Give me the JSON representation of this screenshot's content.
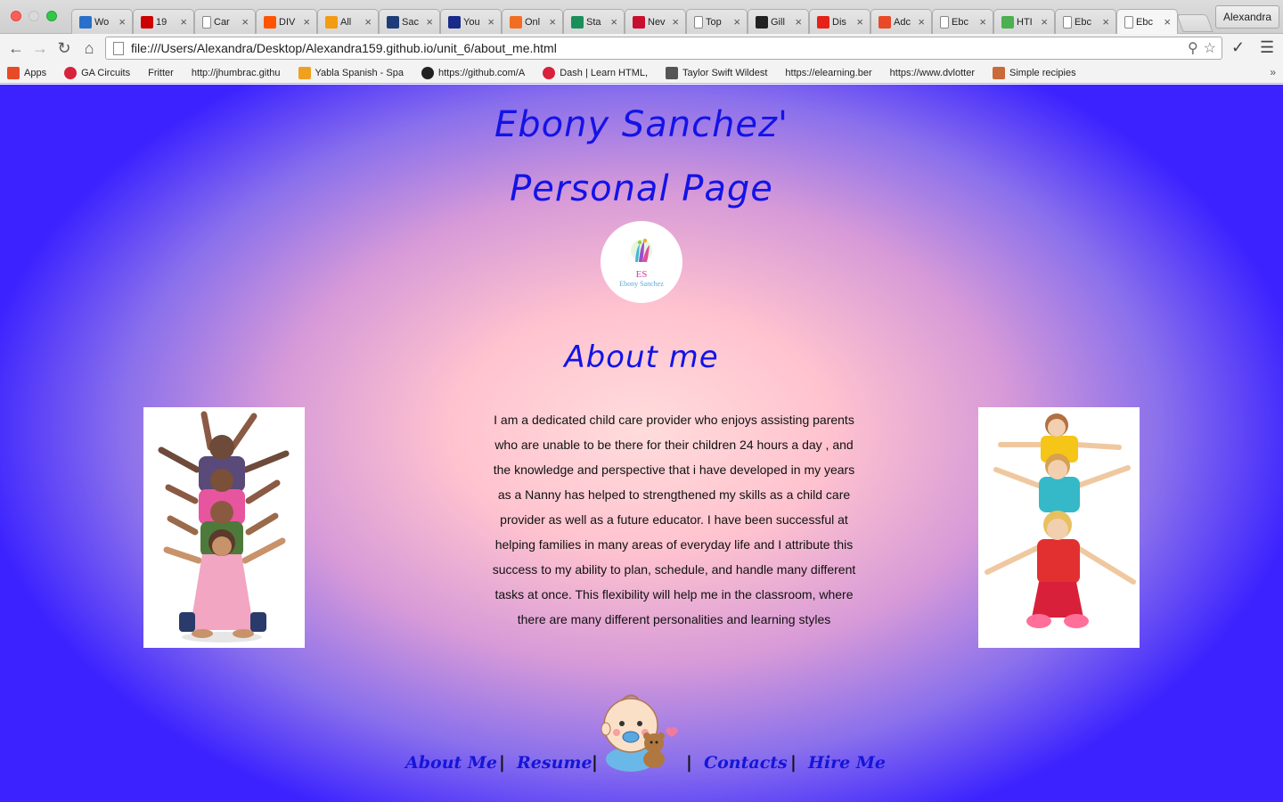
{
  "browser": {
    "tabs": [
      {
        "label": "Wo",
        "icon": "globe-icon",
        "color": "#2a6fc9"
      },
      {
        "label": "19",
        "icon": "cnn-icon",
        "color": "#cc0000"
      },
      {
        "label": "Car",
        "icon": "page-icon",
        "color": "#ffffff"
      },
      {
        "label": "DIV",
        "icon": "soundcloud-icon",
        "color": "#ff5500"
      },
      {
        "label": "All",
        "icon": "star-icon",
        "color": "#f39c12"
      },
      {
        "label": "Sac",
        "icon": "grid-icon",
        "color": "#1e3c78"
      },
      {
        "label": "You",
        "icon": "f-icon",
        "color": "#1a2a8a"
      },
      {
        "label": "Onl",
        "icon": "arrow-icon",
        "color": "#f26d21"
      },
      {
        "label": "Sta",
        "icon": "up-icon",
        "color": "#1a8f5a"
      },
      {
        "label": "Nev",
        "icon": "cart-icon",
        "color": "#c8102e"
      },
      {
        "label": "Top",
        "icon": "page-icon",
        "color": "#ffffff"
      },
      {
        "label": "Gill",
        "icon": "g-icon",
        "color": "#222222"
      },
      {
        "label": "Dis",
        "icon": "youtube-icon",
        "color": "#e62117"
      },
      {
        "label": "Adc",
        "icon": "apps-grid-icon",
        "color": "#e84a27"
      },
      {
        "label": "Ebc",
        "icon": "page-icon",
        "color": "#ffffff"
      },
      {
        "label": "HTI",
        "icon": "w3-icon",
        "color": "#4caf50"
      },
      {
        "label": "Ebc",
        "icon": "page-icon",
        "color": "#ffffff"
      },
      {
        "label": "Ebc",
        "icon": "page-icon",
        "color": "#ffffff"
      }
    ],
    "profile_name": "Alexandra",
    "url": "file:///Users/Alexandra/Desktop/Alexandra159.github.io/unit_6/about_me.html",
    "bookmarks": [
      {
        "label": "Apps",
        "icon": "apps-icon"
      },
      {
        "label": "GA Circuits",
        "icon": "ga-icon"
      },
      {
        "label": "Fritter",
        "icon": "page-icon"
      },
      {
        "label": "http://jhumbrac.githu",
        "icon": "page-icon"
      },
      {
        "label": "Yabla Spanish - Spa",
        "icon": "yabla-icon"
      },
      {
        "label": "https://github.com/A",
        "icon": "github-icon"
      },
      {
        "label": "Dash | Learn HTML,",
        "icon": "ga-icon"
      },
      {
        "label": "Taylor Swift Wildest",
        "icon": "speaker-icon"
      },
      {
        "label": "https://elearning.ber",
        "icon": "page-icon"
      },
      {
        "label": "https://www.dvlotter",
        "icon": "page-icon"
      },
      {
        "label": "Simple recipies",
        "icon": "flower-icon"
      }
    ],
    "more_bookmarks": "»"
  },
  "page": {
    "title_line1": "Ebony Sanchez'",
    "title_line2": "Personal Page",
    "logo_initials": "ES",
    "logo_name": "Ebony Sanchez",
    "about_heading": "About me",
    "about_text": "I am a dedicated child care provider who enjoys assisting parents who are unable to be there for their children 24 hours a day , and the knowledge and perspective that i have developed in my years as a Nanny has helped to strengthened my skills as a child care provider as well as a future educator. I have been successful at helping families in many areas of everyday life and I attribute this success to my ability to plan, schedule, and handle many different tasks at once. This flexibility will help me in the classroom, where there are many different personalities and learning styles",
    "nav": {
      "about": "About Me",
      "resume": "Resume",
      "contacts": "Contacts",
      "hire": "Hire Me",
      "separator": "|"
    },
    "colors": {
      "heading": "#1313e6",
      "nav_link": "#1515d8"
    }
  }
}
